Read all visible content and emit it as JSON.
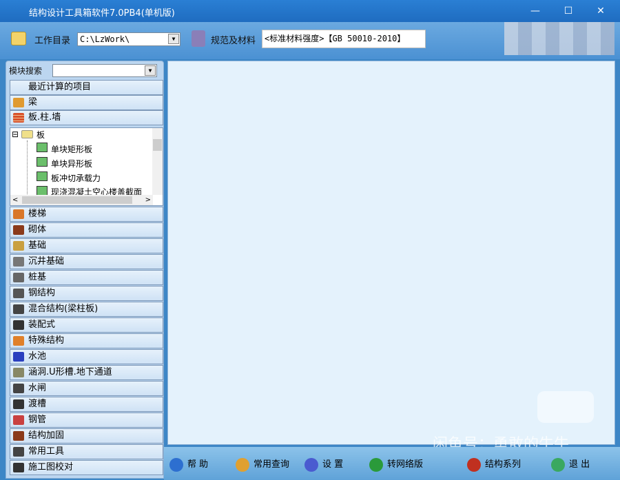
{
  "window": {
    "title": "结构设计工具箱软件7.0PB4(单机版)",
    "minimize": "—",
    "maximize": "☐",
    "close": "✕"
  },
  "toolbar": {
    "workdir_label": "工作目录",
    "workdir_value": "C:\\LzWork\\",
    "code_label": "规范及材料",
    "code_value": "<标准材料强度>【GB 50010-2010】"
  },
  "sidebar": {
    "search_label": "模块搜索",
    "search_value": "",
    "top_items": [
      {
        "label": "最近计算的项目",
        "icon": ""
      },
      {
        "label": "梁",
        "icon": "beam-icon"
      },
      {
        "label": "板.柱.墙",
        "icon": "brick-wall-icon"
      }
    ],
    "tree": {
      "root": "板",
      "children": [
        "单块矩形板",
        "单块异形板",
        "板冲切承载力",
        "现浇混凝土空心楼盖截面"
      ]
    },
    "items": [
      {
        "label": "楼梯",
        "icon": "stairs-icon",
        "color": "#d9772a"
      },
      {
        "label": "砌体",
        "icon": "masonry-icon",
        "color": "#8b3a1a"
      },
      {
        "label": "基础",
        "icon": "foundation-icon",
        "color": "#c9a040"
      },
      {
        "label": "沉井基础",
        "icon": "caisson-icon",
        "color": "#777777"
      },
      {
        "label": "桩基",
        "icon": "pile-icon",
        "color": "#666666"
      },
      {
        "label": "钢结构",
        "icon": "steel-icon",
        "color": "#555555"
      },
      {
        "label": "混合结构(梁柱板)",
        "icon": "composite-icon",
        "color": "#444444"
      },
      {
        "label": "装配式",
        "icon": "prefab-icon",
        "color": "#333333"
      },
      {
        "label": "特殊结构",
        "icon": "special-icon",
        "color": "#e0802a"
      },
      {
        "label": "水池",
        "icon": "pool-icon",
        "color": "#2a3fbf"
      },
      {
        "label": "涵洞.U形槽.地下通道",
        "icon": "culvert-icon",
        "color": "#888866"
      },
      {
        "label": "水闸",
        "icon": "sluice-icon",
        "color": "#444444"
      },
      {
        "label": "渡槽",
        "icon": "aqueduct-icon",
        "color": "#333333"
      },
      {
        "label": "钢管",
        "icon": "steel-pipe-icon",
        "color": "#c94040"
      },
      {
        "label": "结构加固",
        "icon": "reinforce-icon",
        "color": "#8b3a1a"
      },
      {
        "label": "常用工具",
        "icon": "tools-icon",
        "color": "#444444"
      },
      {
        "label": "施工图校对",
        "icon": "drawing-check-icon",
        "color": "#333333"
      }
    ]
  },
  "bottom": [
    {
      "label": "帮 助",
      "icon": "help-icon",
      "color": "#2d6fd0"
    },
    {
      "label": "常用查询",
      "icon": "wrench-icon",
      "color": "#e0a030"
    },
    {
      "label": "设 置",
      "icon": "gear-icon",
      "color": "#4a5bd0"
    },
    {
      "label": "转网络版",
      "icon": "globe-icon",
      "color": "#2a9a3a"
    },
    {
      "label": "结构系列",
      "icon": "structure-series-icon",
      "color": "#c03020"
    },
    {
      "label": "退 出",
      "icon": "exit-door-icon",
      "color": "#3aa860"
    }
  ],
  "watermark": {
    "text": "闲鱼号：勇敢的牛牛",
    "logo": "闲鱼"
  }
}
